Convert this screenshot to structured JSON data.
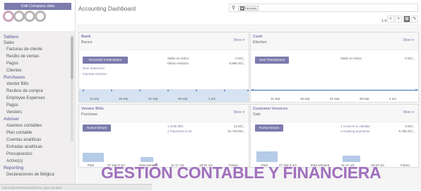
{
  "sidebar": {
    "edit_company": "Edit Company data",
    "menu": [
      {
        "kind": "sec",
        "label": "Tablero"
      },
      {
        "kind": "sub",
        "label": "Sales"
      },
      {
        "kind": "it",
        "label": "Facturas de cliente"
      },
      {
        "kind": "it",
        "label": "Recibo de ventas"
      },
      {
        "kind": "it",
        "label": "Pagos"
      },
      {
        "kind": "it",
        "label": "Clientes"
      },
      {
        "kind": "sec",
        "label": "Purchases"
      },
      {
        "kind": "it",
        "label": "Vendor Bills"
      },
      {
        "kind": "it",
        "label": "Recibos de compra"
      },
      {
        "kind": "it",
        "label": "Employee Expenses"
      },
      {
        "kind": "it",
        "label": "Pagos"
      },
      {
        "kind": "it",
        "label": "Vendors"
      },
      {
        "kind": "sec",
        "label": "Adviser"
      },
      {
        "kind": "it",
        "label": "Asientos contables"
      },
      {
        "kind": "it",
        "label": "Plan contable"
      },
      {
        "kind": "it",
        "label": "Cuentas analíticas"
      },
      {
        "kind": "it",
        "label": "Entradas analíticas"
      },
      {
        "kind": "it",
        "label": "Presupuestos"
      },
      {
        "kind": "it",
        "label": "Activo(s)"
      },
      {
        "kind": "sec",
        "label": "Reporting"
      },
      {
        "kind": "it",
        "label": "Declaraciones de Bélgica"
      }
    ]
  },
  "header": {
    "title": "Accounting Dashboard",
    "filter_tag": "Favorites",
    "filter_tag_badge": "★",
    "pager": "1-4 / 4",
    "prev": "<",
    "next": ">"
  },
  "bank": {
    "title": "Bank",
    "subtitle": "Banco",
    "more": "More ▾",
    "button": "Reconcile 5 Elementos",
    "link1": "New Statement",
    "link2": "Importar extracto",
    "lbl1": "Saldo en Odoo",
    "lbl2": "Último extracto",
    "val1": "0.00 [..",
    "val2": "8,998.20 [..",
    "xlabels": [
      "11 sep",
      "16 sep",
      "21 sep",
      "26 sep",
      "1 oct"
    ]
  },
  "cash": {
    "title": "Cash",
    "subtitle": "Efectivo",
    "more": "More ▾",
    "button": "New Transactions",
    "lbl1": "Saldo en Odoo",
    "val1": "0.00 [..",
    "xlabels": [
      "11 sep",
      "16 sep",
      "21 sep",
      "26 sep",
      "1 oct"
    ]
  },
  "vendor": {
    "title": "Vendor Bills",
    "subtitle": "Purchase",
    "more": "More ▾",
    "button": "Nueva factura",
    "link1": "1 Draft bills",
    "link2": "2 Payments to do",
    "val1": "14.00 [..",
    "val2": "15,749.99 [..",
    "xlabels": [
      "Past",
      "27 sep-3 oct",
      "Esta semana",
      "11-17 oct",
      "18-24 oct",
      "Futuro"
    ]
  },
  "customer": {
    "title": "Customer Invoices",
    "subtitle": "Sale",
    "more": "More ▾",
    "button": "Nueva factura",
    "link1": "1 Invoices to validate",
    "link2": "3 Awaiting payments",
    "val1": "0.00 [..",
    "val2": "5,785.00 [..",
    "xlabels": [
      "Past",
      "27 sep-3 oct",
      "Esta semana",
      "11-17 oct",
      "18-24 oct",
      "Futuro"
    ]
  },
  "overlay": "GESTIÓN CONTABLE Y FINANCIERA",
  "status": "http://odoo8:8069/web#view_type=kanban"
}
